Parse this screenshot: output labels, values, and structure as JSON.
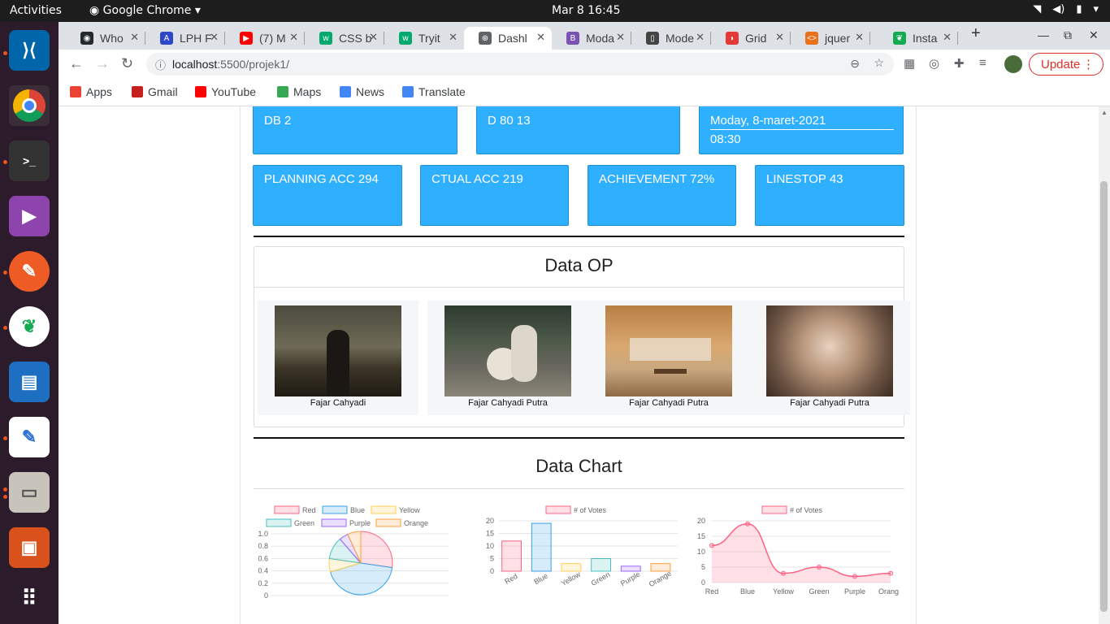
{
  "system": {
    "activities": "Activities",
    "app_name": "Google Chrome",
    "clock": "Mar 8  16:45"
  },
  "tabs": [
    {
      "label": "Who",
      "fav_color": "#24292e",
      "fav_icon": "github-icon",
      "fav_text": "◉"
    },
    {
      "label": "LPH F",
      "fav_color": "#2e47c9",
      "fav_icon": "lph-icon",
      "fav_text": "A"
    },
    {
      "label": "(7) M",
      "fav_color": "#ff0000",
      "fav_icon": "youtube-icon",
      "fav_text": "▶"
    },
    {
      "label": "CSS b",
      "fav_color": "#04aa6d",
      "fav_icon": "w3schools-icon",
      "fav_text": "w"
    },
    {
      "label": "Tryit",
      "fav_color": "#04aa6d",
      "fav_icon": "w3schools-icon",
      "fav_text": "w"
    },
    {
      "label": "Dashl",
      "fav_color": "#5f6368",
      "fav_icon": "globe-icon",
      "fav_text": "⊕"
    },
    {
      "label": "Moda",
      "fav_color": "#7952b3",
      "fav_icon": "bootstrap-icon",
      "fav_text": "B"
    },
    {
      "label": "Mode",
      "fav_color": "#444",
      "fav_icon": "book-icon",
      "fav_text": "▯"
    },
    {
      "label": "Grid",
      "fav_color": "#e53935",
      "fav_icon": "grid-icon",
      "fav_text": "◗"
    },
    {
      "label": "jquer",
      "fav_color": "#e8711a",
      "fav_icon": "code-icon",
      "fav_text": "<>"
    },
    {
      "label": "Insta",
      "fav_color": "#13aa52",
      "fav_icon": "mongodb-icon",
      "fav_text": "❦"
    }
  ],
  "address": {
    "host": "localhost",
    "path": ":5500/projek1/"
  },
  "update_label": "Update",
  "bookmarks": [
    {
      "label": "Apps",
      "color": "#ea4335",
      "icon": "apps-grid-icon"
    },
    {
      "label": "Gmail",
      "color": "#c5221f",
      "icon": "gmail-icon"
    },
    {
      "label": "YouTube",
      "color": "#ff0000",
      "icon": "youtube-icon"
    },
    {
      "label": "Maps",
      "color": "#34a853",
      "icon": "maps-pin-icon"
    },
    {
      "label": "News",
      "color": "#4285f4",
      "icon": "news-icon"
    },
    {
      "label": "Translate",
      "color": "#4285f4",
      "icon": "translate-icon"
    }
  ],
  "cards_top": [
    "DB 2",
    "D 80 13"
  ],
  "datetime": {
    "date": "Moday, 8-maret-2021",
    "time": "08:30"
  },
  "cards_kpi": [
    "PLANNING ACC 294",
    "CTUAL ACC 219",
    "ACHIEVEMENT 72%",
    "LINESTOP 43"
  ],
  "data_op": {
    "title": "Data OP",
    "people": [
      {
        "name": "Fajar Cahyadi"
      },
      {
        "name": "Fajar Cahyadi Putra"
      },
      {
        "name": "Fajar Cahyadi Putra"
      },
      {
        "name": "Fajar Cahyadi Putra"
      }
    ]
  },
  "data_chart_title": "Data Chart",
  "colors": {
    "card": "#2fb0ff",
    "accent_pink": "#ff6384"
  },
  "chart_data": [
    {
      "type": "pie",
      "categories": [
        "Red",
        "Blue",
        "Yellow",
        "Green",
        "Purple",
        "Orange"
      ],
      "values": [
        12,
        19,
        3,
        5,
        2,
        3
      ],
      "colors": [
        "#ff6384",
        "#36a2eb",
        "#ffce56",
        "#4bc0c0",
        "#9966ff",
        "#ff9f40"
      ],
      "yticks": [
        "1.0",
        "0.8",
        "0.6",
        "0.4",
        "0.2",
        "0"
      ],
      "legend": "top"
    },
    {
      "type": "bar",
      "categories": [
        "Red",
        "Blue",
        "Yellow",
        "Green",
        "Purple",
        "Orange"
      ],
      "series": [
        {
          "name": "# of Votes",
          "values": [
            12,
            19,
            3,
            5,
            2,
            3
          ]
        }
      ],
      "colors": [
        "#ff6384",
        "#36a2eb",
        "#ffce56",
        "#4bc0c0",
        "#9966ff",
        "#ff9f40"
      ],
      "ylim": [
        0,
        20
      ],
      "yticks": [
        "20",
        "15",
        "10",
        "5",
        "0"
      ],
      "legend": "top"
    },
    {
      "type": "area",
      "categories": [
        "Red",
        "Blue",
        "Yellow",
        "Green",
        "Purple",
        "Orange"
      ],
      "series": [
        {
          "name": "# of Votes",
          "values": [
            12,
            19,
            3,
            5,
            2,
            3
          ]
        }
      ],
      "ylim": [
        0,
        20
      ],
      "yticks": [
        "20",
        "15",
        "10",
        "5",
        "0"
      ],
      "legend": "top"
    }
  ]
}
